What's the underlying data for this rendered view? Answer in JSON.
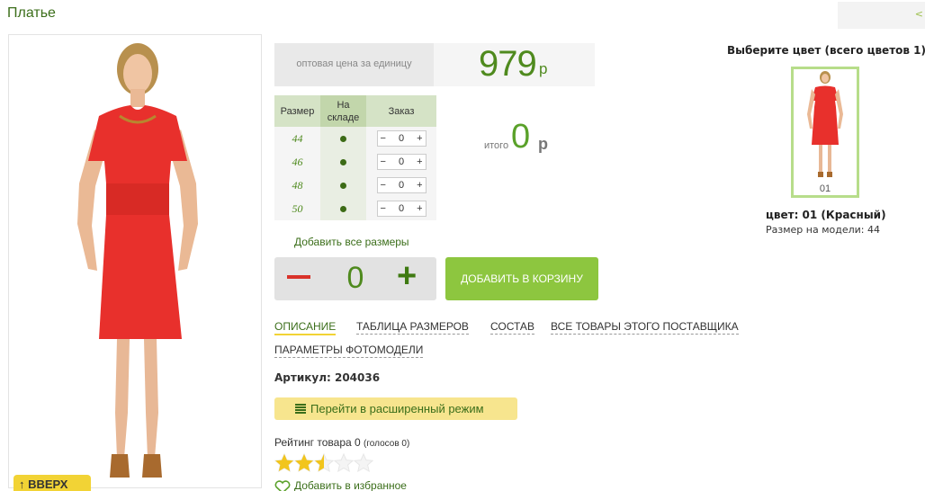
{
  "product": {
    "title": "Платье",
    "top_right_arrow": "<"
  },
  "photo": {
    "up_label": "↑ ВВЕРХ"
  },
  "price": {
    "label": "оптовая цена за единицу",
    "value": "979",
    "currency": "р"
  },
  "size_table": {
    "headers": {
      "size": "Размер",
      "stock": "На складе",
      "order": "Заказ"
    },
    "rows": [
      {
        "size": "44",
        "qty": "0"
      },
      {
        "size": "46",
        "qty": "0"
      },
      {
        "size": "48",
        "qty": "0"
      },
      {
        "size": "50",
        "qty": "0"
      }
    ],
    "minus": "−",
    "plus": "+"
  },
  "total": {
    "label": "итого",
    "value": "0",
    "currency": "р"
  },
  "add_all_sizes": "Добавить все размеры",
  "quantity": {
    "value": "0",
    "plus": "+"
  },
  "cart_button": "ДОБАВИТЬ В КОРЗИНУ",
  "tabs": [
    {
      "label": "ОПИСАНИЕ",
      "active": true
    },
    {
      "label": "ТАБЛИЦА РАЗМЕРОВ"
    },
    {
      "label": "СОСТАВ"
    },
    {
      "label": "ВСЕ ТОВАРЫ ЭТОГО ПОСТАВЩИКА"
    },
    {
      "label": "ПАРАМЕТРЫ ФОТОМОДЕЛИ"
    }
  ],
  "article": "Артикул: 204036",
  "advanced_mode": "Перейти в расширенный режим",
  "rating": {
    "label": "Рейтинг товара 0",
    "votes": "(голосов 0)",
    "stars_filled": 2.5,
    "stars_total": 5
  },
  "favorite": "Добавить в избранное",
  "colors": {
    "title": "Выберите цвет (всего цветов 1)",
    "items": [
      {
        "code": "01"
      }
    ],
    "selected_name": "цвет: 01 (Красный)",
    "model_size": "Размер на модели: 44"
  },
  "theme": {
    "accent_green": "#4f8a1e",
    "cart_green": "#8dc63f",
    "dress_red": "#e8302c",
    "highlight_yellow": "#f2d335"
  }
}
